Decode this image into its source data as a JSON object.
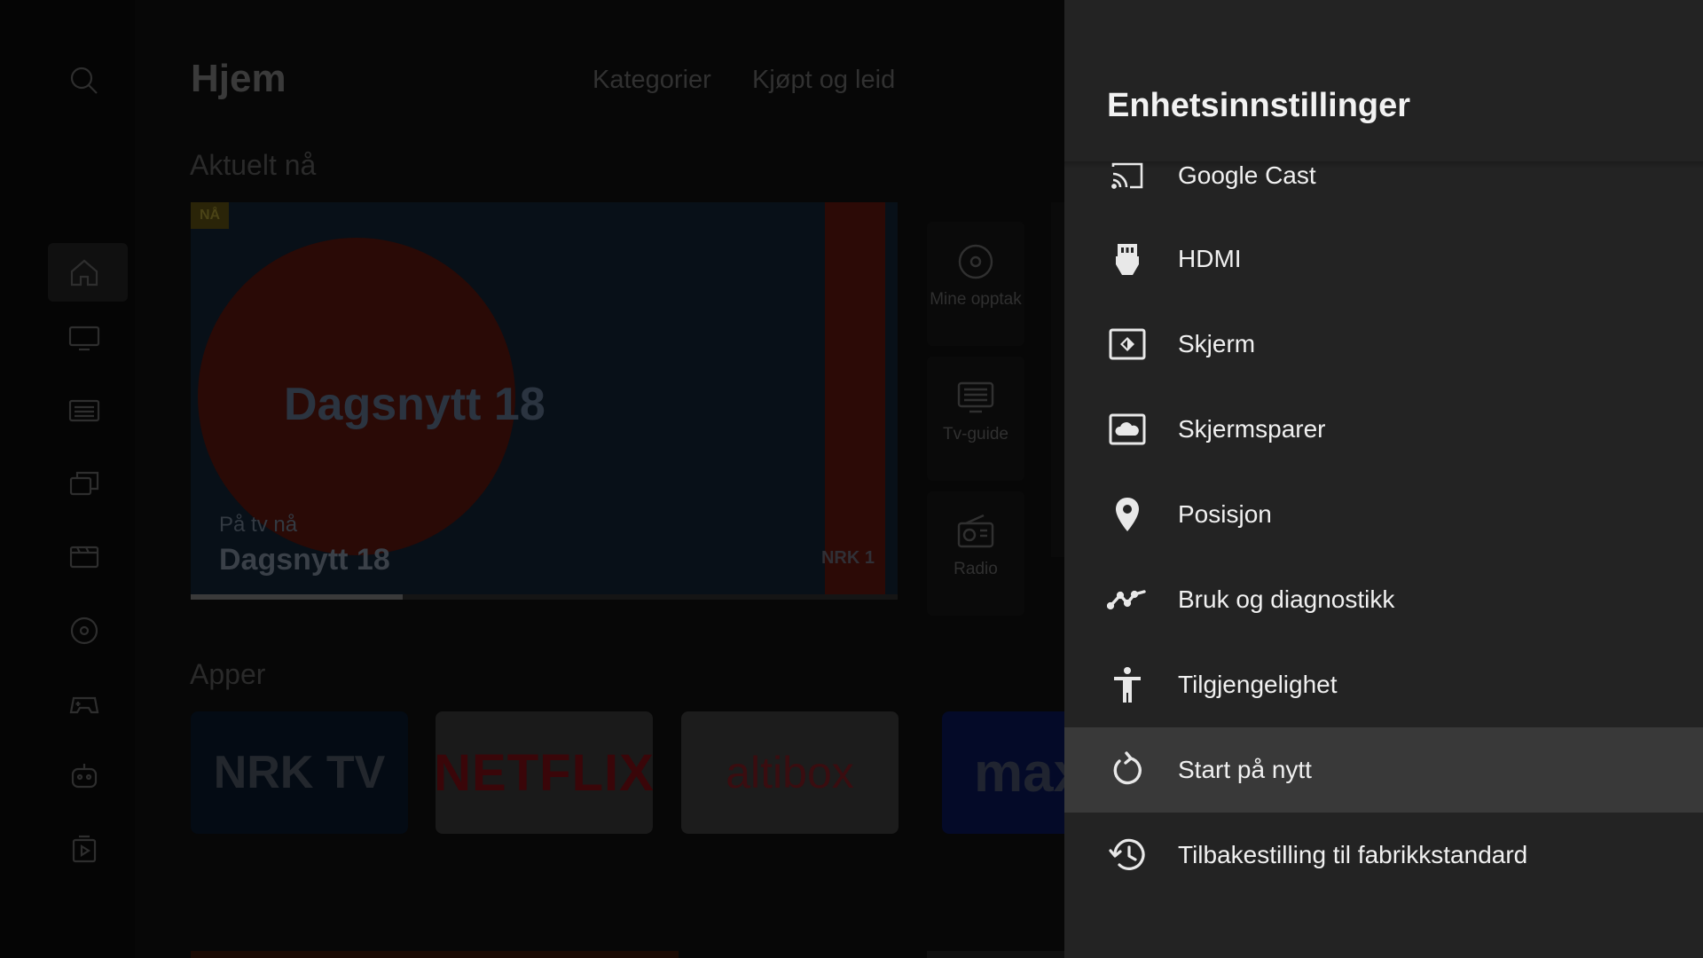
{
  "home": {
    "title": "Hjem",
    "tabs": [
      "Kategorier",
      "Kjøpt og leid"
    ],
    "section_now": "Aktuelt nå",
    "hero": {
      "badge": "NÅ",
      "logo_text": "Dagsnytt 18",
      "subtitle": "På tv nå",
      "title": "Dagsnytt 18",
      "channel": "NRK 1",
      "progress_percent": 30
    },
    "side_tiles": [
      "Mine opptak",
      "Tv-guide",
      "Radio"
    ],
    "section_apps": "Apper",
    "apps": [
      "NRK TV",
      "NETFLIX",
      "altibox",
      "max"
    ],
    "rail_icons": [
      "search-icon",
      "home-icon",
      "tv-icon",
      "tv-guide-icon",
      "library-icon",
      "movies-icon",
      "recordings-icon",
      "games-icon",
      "kids-icon",
      "rental-icon"
    ]
  },
  "settings": {
    "title": "Enhetsinnstillinger",
    "items": [
      {
        "label": "Google Cast",
        "icon": "cast-icon"
      },
      {
        "label": "HDMI",
        "icon": "hdmi-icon"
      },
      {
        "label": "Skjerm",
        "icon": "display-icon"
      },
      {
        "label": "Skjermsparer",
        "icon": "screensaver-icon"
      },
      {
        "label": "Posisjon",
        "icon": "location-icon"
      },
      {
        "label": "Bruk og diagnostikk",
        "icon": "diagnostics-icon"
      },
      {
        "label": "Tilgjengelighet",
        "icon": "accessibility-icon"
      },
      {
        "label": "Start på nytt",
        "icon": "restart-icon",
        "focused": true
      },
      {
        "label": "Tilbakestilling til fabrikkstandard",
        "icon": "factory-reset-icon"
      }
    ]
  },
  "colors": {
    "panel_bg": "#232323",
    "focused_row_bg": "#393939",
    "text": "#f0f0f0"
  }
}
